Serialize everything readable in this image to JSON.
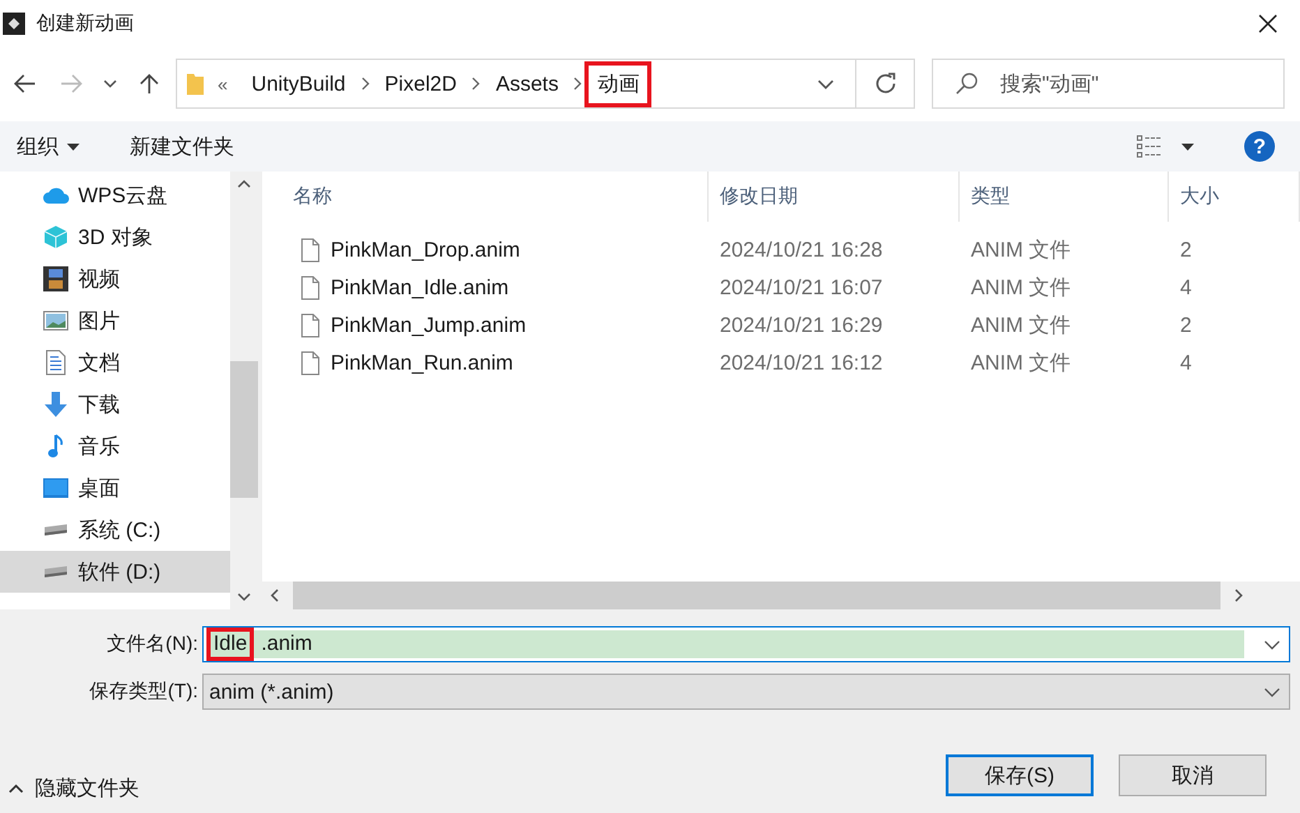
{
  "window": {
    "title": "创建新动画"
  },
  "address": {
    "overflow": "«",
    "crumbs": [
      {
        "label": "UnityBuild",
        "highlighted": false
      },
      {
        "label": "Pixel2D",
        "highlighted": false
      },
      {
        "label": "Assets",
        "highlighted": false
      },
      {
        "label": "动画",
        "highlighted": true
      }
    ]
  },
  "search": {
    "placeholder": "搜索\"动画\""
  },
  "toolbar": {
    "organize": "组织",
    "new_folder": "新建文件夹",
    "help": "?"
  },
  "sidebar": {
    "items": [
      {
        "label": "WPS云盘",
        "kind": "cloud",
        "selected": false
      },
      {
        "label": "3D 对象",
        "kind": "cube",
        "selected": false
      },
      {
        "label": "视频",
        "kind": "film",
        "selected": false
      },
      {
        "label": "图片",
        "kind": "picture",
        "selected": false
      },
      {
        "label": "文档",
        "kind": "document",
        "selected": false
      },
      {
        "label": "下载",
        "kind": "download",
        "selected": false
      },
      {
        "label": "音乐",
        "kind": "music",
        "selected": false
      },
      {
        "label": "桌面",
        "kind": "desktop",
        "selected": false
      },
      {
        "label": "系统 (C:)",
        "kind": "drive",
        "selected": false
      },
      {
        "label": "软件 (D:)",
        "kind": "drive",
        "selected": true
      }
    ]
  },
  "table": {
    "columns": [
      "名称",
      "修改日期",
      "类型",
      "大小"
    ],
    "rows": [
      {
        "name": "PinkMan_Drop.anim",
        "date": "2024/10/21 16:28",
        "type": "ANIM 文件",
        "size": "2"
      },
      {
        "name": "PinkMan_Idle.anim",
        "date": "2024/10/21 16:07",
        "type": "ANIM 文件",
        "size": "4"
      },
      {
        "name": "PinkMan_Jump.anim",
        "date": "2024/10/21 16:29",
        "type": "ANIM 文件",
        "size": "2"
      },
      {
        "name": "PinkMan_Run.anim",
        "date": "2024/10/21 16:12",
        "type": "ANIM 文件",
        "size": "4"
      }
    ]
  },
  "filename": {
    "label": "文件名(N):",
    "parts": [
      {
        "text": "Idle",
        "highlighted": true
      },
      {
        "text": ".anim",
        "highlighted": false
      }
    ]
  },
  "filetype": {
    "label": "保存类型(T):",
    "value": "anim (*.anim)"
  },
  "hide_folders": "隐藏文件夹",
  "buttons": [
    {
      "label": "保存(S)",
      "default": true
    },
    {
      "label": "取消",
      "default": false
    }
  ]
}
